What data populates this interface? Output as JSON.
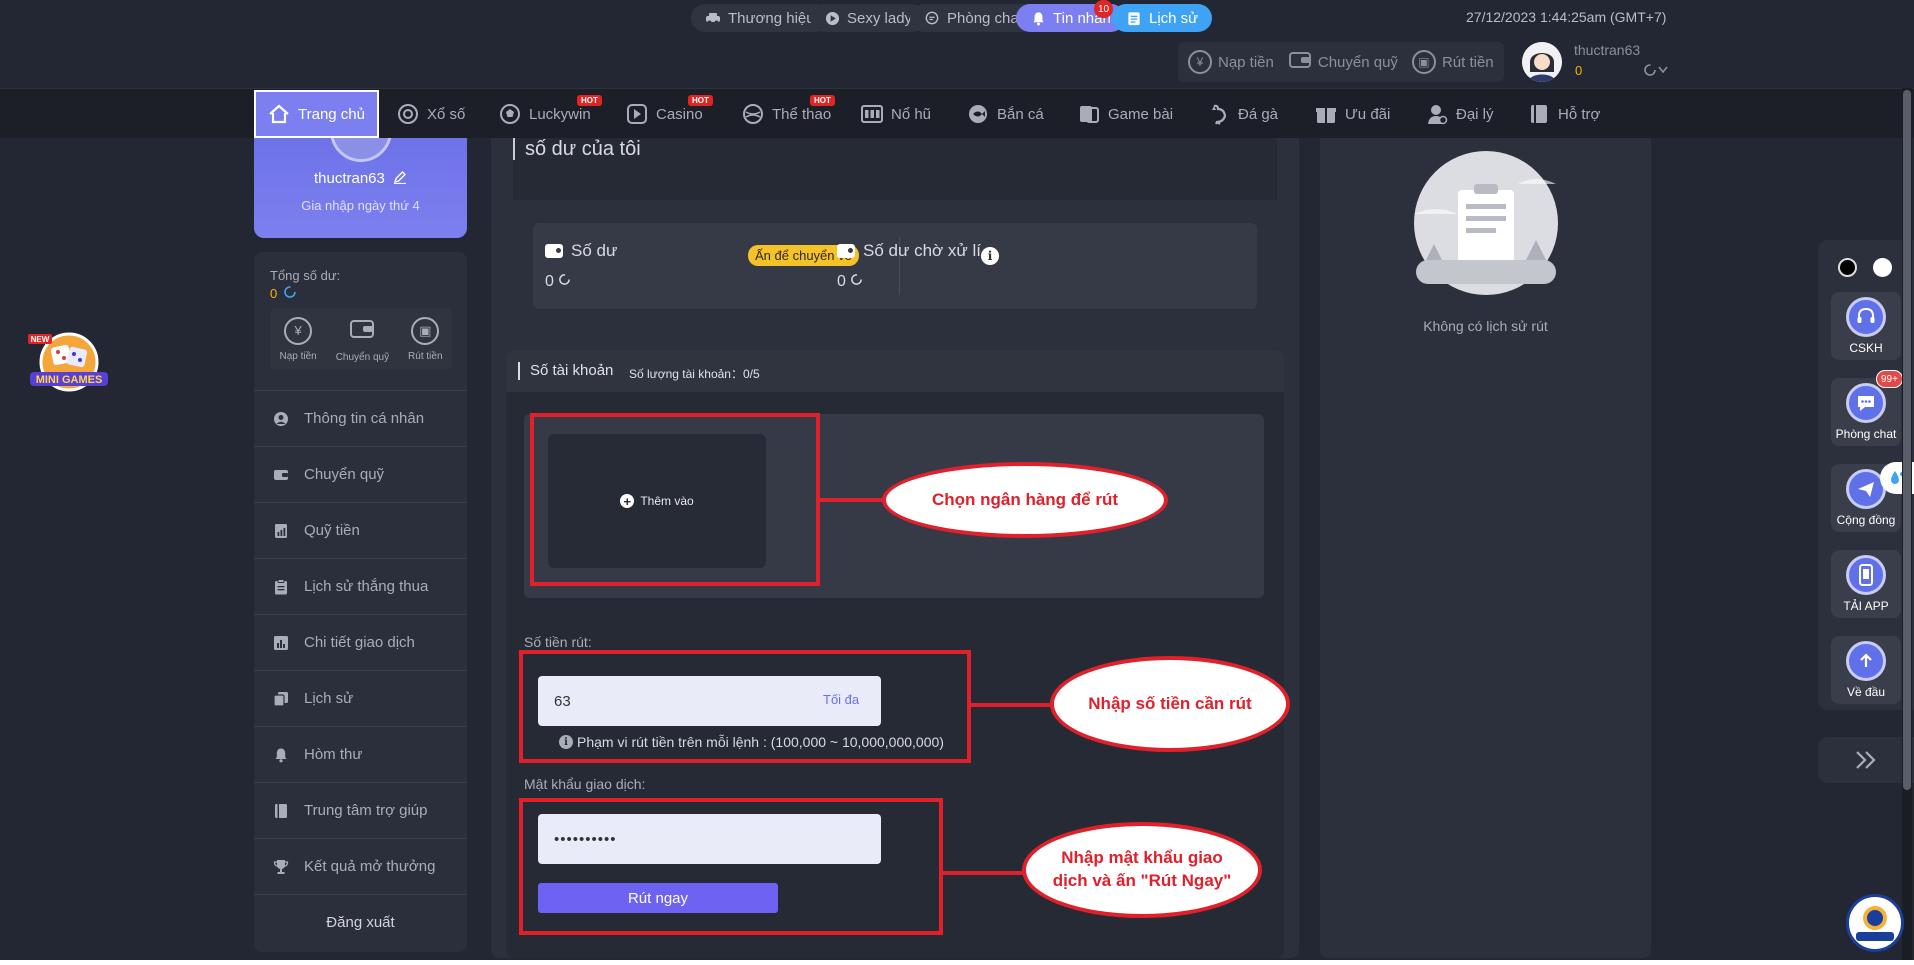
{
  "topbar": {
    "pills": [
      {
        "label": "Thương hiệu",
        "icon": "car-icon"
      },
      {
        "label": "Sexy lady",
        "icon": "play-icon"
      },
      {
        "label": "Phòng chat",
        "icon": "chat-icon"
      },
      {
        "label": "Tin nhắn",
        "icon": "bell-icon",
        "badge": "10"
      },
      {
        "label": "Lịch sử",
        "icon": "history-icon"
      }
    ],
    "datetime": "27/12/2023 1:44:25am  (GMT+7)",
    "actions": {
      "deposit": "Nạp tiền",
      "transfer": "Chuyển quỹ",
      "withdraw": "Rút tiền"
    },
    "user": {
      "name": "thuctran63",
      "balance": "0"
    }
  },
  "nav": {
    "items": [
      {
        "label": "Trang chủ",
        "icon": "home-icon"
      },
      {
        "label": "Xổ số",
        "icon": "lottery-icon"
      },
      {
        "label": "Luckywin",
        "icon": "soccer-icon",
        "badge": "HOT"
      },
      {
        "label": "Casino",
        "icon": "casino-icon",
        "badge": "HOT"
      },
      {
        "label": "Thể thao",
        "icon": "sports-icon",
        "badge": "HOT"
      },
      {
        "label": "Nổ hũ",
        "icon": "slot-icon"
      },
      {
        "label": "Bắn cá",
        "icon": "fish-icon"
      },
      {
        "label": "Game bài",
        "icon": "cards-icon"
      },
      {
        "label": "Đá gà",
        "icon": "rooster-icon"
      },
      {
        "label": "Ưu đãi",
        "icon": "gift-icon"
      },
      {
        "label": "Đại lý",
        "icon": "agent-icon"
      },
      {
        "label": "Hỗ trợ",
        "icon": "book-icon"
      }
    ]
  },
  "profile": {
    "name": "thuctran63",
    "joined": "Gia nhập ngày thứ 4"
  },
  "sidebar": {
    "total_label": "Tổng số dư:",
    "total_value": "0",
    "quick": {
      "deposit": "Nạp tiền",
      "transfer": "Chuyển quỹ",
      "withdraw": "Rút tiền"
    },
    "menu": [
      {
        "label": "Thông tin cá nhân",
        "icon": "user-icon"
      },
      {
        "label": "Chuyển quỹ",
        "icon": "wallet-icon"
      },
      {
        "label": "Quỹ tiền",
        "icon": "fund-icon"
      },
      {
        "label": "Lịch sử thắng thua",
        "icon": "clipboard-icon"
      },
      {
        "label": "Chi tiết giao dịch",
        "icon": "chart-icon"
      },
      {
        "label": "Lịch sử",
        "icon": "stack-icon"
      },
      {
        "label": "Hòm thư",
        "icon": "bell-icon"
      },
      {
        "label": "Trung tâm trợ giúp",
        "icon": "book-icon"
      },
      {
        "label": "Kết quả mở thưởng",
        "icon": "trophy-icon"
      }
    ],
    "logout": "Đăng xuất"
  },
  "main": {
    "title": "số dư của tôi",
    "balance_label": "Số dư",
    "balance_value": "0",
    "recall_label": "Ấn để chuyển về",
    "pending_label": "Số dư chờ xử lí",
    "pending_value": "0",
    "account_title": "Số tài khoản",
    "account_count": "Số lượng tài khoản：0/5",
    "add_label": "Thêm vào",
    "amount_label": "Số tiền rút:",
    "amount_value": "63",
    "max_label": "Tối đa",
    "range_text": "Phạm vi rút tiền trên mỗi lệnh : (100,000 ~ 10,000,000,000)",
    "password_label": "Mật khẩu giao dịch:",
    "password_value": "••••••••••",
    "submit_label": "Rút ngay"
  },
  "annotations": {
    "bank": "Chọn ngân hàng để rút",
    "amount": "Nhập số tiền cần rút",
    "password": "Nhập mật khẩu giao dịch và ấn \"Rút Ngay\""
  },
  "right_panel": {
    "empty_text": "Không có lịch sử rút"
  },
  "float_bar": {
    "items": [
      {
        "label": "CSKH",
        "icon": "headset-icon"
      },
      {
        "label": "Phòng chat",
        "icon": "chat-icon",
        "badge": "99+"
      },
      {
        "label": "Cộng đồng",
        "icon": "send-icon"
      },
      {
        "label": "TẢI APP",
        "icon": "phone-icon"
      },
      {
        "label": "Về đầu",
        "icon": "arrow-up-icon"
      }
    ]
  },
  "colors": {
    "accent": "#7b7ff0",
    "annotation": "#e0202a",
    "balance": "#f5b800"
  }
}
